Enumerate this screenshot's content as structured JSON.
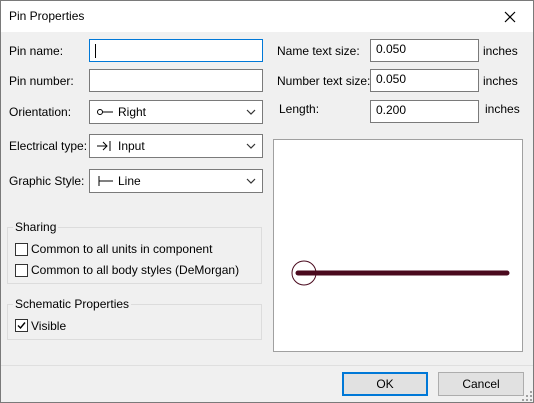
{
  "window": {
    "title": "Pin Properties"
  },
  "fields": {
    "pin_name": {
      "label": "Pin name:",
      "value": ""
    },
    "pin_number": {
      "label": "Pin number:",
      "value": ""
    },
    "orientation": {
      "label": "Orientation:",
      "value": "Right",
      "icon": "pin-right-icon"
    },
    "electrical_type": {
      "label": "Electrical type:",
      "value": "Input",
      "icon": "input-arrow-icon"
    },
    "graphic_style": {
      "label": "Graphic Style:",
      "value": "Line",
      "icon": "line-style-icon"
    },
    "name_text_size": {
      "label": "Name text size:",
      "value": "0.050",
      "unit": "inches"
    },
    "number_text_size": {
      "label": "Number text size:",
      "value": "0.050",
      "unit": "inches"
    },
    "length": {
      "label": "Length:",
      "value": "0.200",
      "unit": "inches"
    }
  },
  "sharing": {
    "title": "Sharing",
    "common_units": {
      "label": "Common to all units in component",
      "checked": false
    },
    "common_body_styles": {
      "label": "Common to all body styles (DeMorgan)",
      "checked": false
    }
  },
  "schematic": {
    "title": "Schematic Properties",
    "visible": {
      "label": "Visible",
      "checked": true
    }
  },
  "preview": {
    "pin_color": "#4a0a1e"
  },
  "buttons": {
    "ok": "OK",
    "cancel": "Cancel"
  },
  "colors": {
    "accent": "#0078d7"
  }
}
